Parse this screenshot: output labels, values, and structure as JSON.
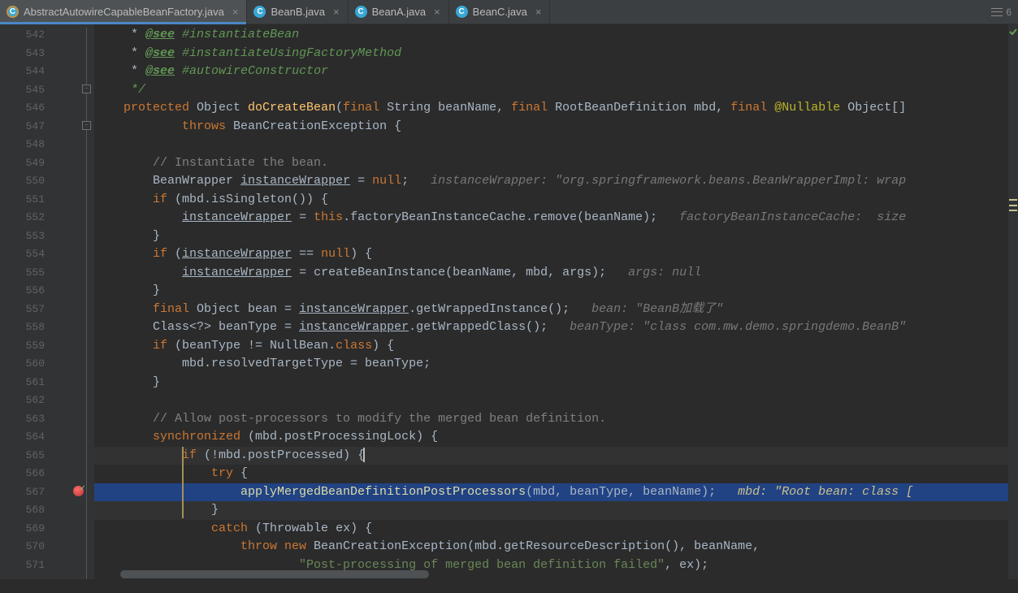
{
  "tabs": [
    {
      "label": "AbstractAutowireCapableBeanFactory.java",
      "active": true,
      "iconVariant": "orange"
    },
    {
      "label": "BeanB.java",
      "active": false,
      "iconVariant": "blue"
    },
    {
      "label": "BeanA.java",
      "active": false,
      "iconVariant": "blue"
    },
    {
      "label": "BeanC.java",
      "active": false,
      "iconVariant": "blue"
    }
  ],
  "tabbar_right_count": "6",
  "line_start": 542,
  "line_end": 571,
  "breakpoint_line": 567,
  "execution_line": 567,
  "caret_line": 565,
  "code": {
    "l542": {
      "tag1": "@see",
      "ref1": "#instantiateBean"
    },
    "l543": {
      "tag1": "@see",
      "ref1": "#instantiateUsingFactoryMethod"
    },
    "l544": {
      "tag1": "@see",
      "ref1": "#autowireConstructor"
    },
    "l545": {
      "text": " */"
    },
    "l546": {
      "kw1": "protected",
      "t1": " Object ",
      "fn": "doCreateBean",
      "p1": "(",
      "kw2": "final",
      "t2": " String beanName, ",
      "kw3": "final",
      "t3": " RootBeanDefinition mbd, ",
      "kw4": "final",
      "ann": " @Nullable",
      "t4": " Object[]"
    },
    "l547": {
      "kw1": "throws",
      "t1": " BeanCreationException {"
    },
    "l549": {
      "text": "// Instantiate the bean."
    },
    "l550": {
      "t1": "BeanWrapper ",
      "u1": "instanceWrapper",
      "t2": " = ",
      "kw": "null",
      "t3": ";",
      "hint": "   instanceWrapper: \"org.springframework.beans.BeanWrapperImpl: wrap"
    },
    "l551": {
      "kw": "if",
      "t1": " (mbd.isSingleton()) {"
    },
    "l552": {
      "u1": "instanceWrapper",
      "t1": " = ",
      "kw": "this",
      "t2": ".factoryBeanInstanceCache.remove(beanName);",
      "hint": "   factoryBeanInstanceCache:  size "
    },
    "l553": {
      "t1": "}"
    },
    "l554": {
      "kw": "if",
      "t1": " (",
      "u1": "instanceWrapper",
      "t2": " == ",
      "kw2": "null",
      "t3": ") {"
    },
    "l555": {
      "u1": "instanceWrapper",
      "t1": " = createBeanInstance(beanName, mbd, args);",
      "hint": "   args: null"
    },
    "l556": {
      "t1": "}"
    },
    "l557": {
      "kw": "final",
      "t1": " Object bean = ",
      "u1": "instanceWrapper",
      "t2": ".getWrappedInstance();",
      "hint": "   bean: \"BeanB加载了\""
    },
    "l558": {
      "t0": "Class<?> beanType = ",
      "u1": "instanceWrapper",
      "t1": ".getWrappedClass();",
      "hint": "   beanType: \"class com.mw.demo.springdemo.BeanB\""
    },
    "l559": {
      "kw": "if",
      "t1": " (beanType != NullBean.",
      "kw2": "class",
      "t2": ") {"
    },
    "l560": {
      "t1": "mbd.resolvedTargetType = beanType;"
    },
    "l561": {
      "t1": "}"
    },
    "l563": {
      "text": "// Allow post-processors to modify the merged bean definition."
    },
    "l564": {
      "kw": "synchronized",
      "t1": " (mbd.postProcessingLock) {"
    },
    "l565": {
      "kw": "if",
      "t1": " (!mbd.postProcessed) {"
    },
    "l566": {
      "kw": "try",
      "t1": " {"
    },
    "l567": {
      "fn": "applyMergedBeanDefinitionPostProcessors",
      "t1": "(mbd, beanType, beanName);",
      "hint": "   mbd: \"Root bean: class ["
    },
    "l568": {
      "t1": "}"
    },
    "l569": {
      "kw": "catch",
      "t1": " (Throwable ex) {"
    },
    "l570": {
      "kw": "throw new",
      "t1": " BeanCreationException(mbd.getResourceDescription(), beanName,"
    },
    "l571": {
      "str": "\"Post-processing of merged bean definition failed\"",
      "t1": ", ex);"
    }
  }
}
